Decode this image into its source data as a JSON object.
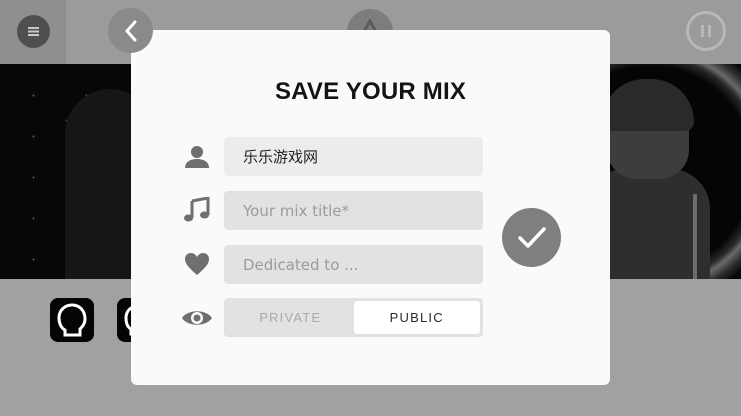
{
  "background": {
    "menu_icon": "hamburger-icon",
    "logo_icon": "app-logo-icon",
    "pause_icon": "pause-icon"
  },
  "modal": {
    "title": "SAVE YOUR MIX",
    "back_icon": "chevron-left-icon",
    "fields": {
      "author": {
        "value": "乐乐游戏网",
        "icon": "user-icon"
      },
      "mix_title": {
        "placeholder": "Your mix title*",
        "icon": "music-note-icon"
      },
      "dedication": {
        "placeholder": "Dedicated to ...",
        "icon": "heart-icon"
      }
    },
    "visibility": {
      "icon": "eye-icon",
      "options": [
        "PRIVATE",
        "PUBLIC"
      ],
      "selected": "PUBLIC"
    },
    "confirm_icon": "checkmark-icon"
  }
}
